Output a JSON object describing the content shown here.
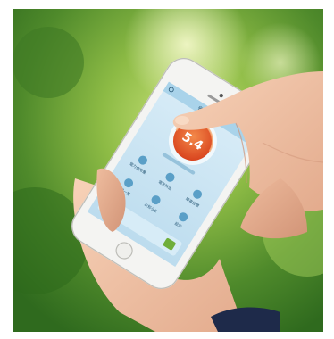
{
  "phone_screen": {
    "header_title": "省エネ状況",
    "gauge_value": "5.4",
    "menu_items": [
      {
        "label": "電力使用量",
        "icon": "bolt-icon"
      },
      {
        "label": "電気料金",
        "icon": "yen-icon"
      },
      {
        "label": "節電目標",
        "icon": "target-icon"
      },
      {
        "label": "機器一覧",
        "icon": "list-icon"
      },
      {
        "label": "お知らせ",
        "icon": "bell-icon"
      },
      {
        "label": "設定",
        "icon": "gear-icon"
      }
    ]
  },
  "colors": {
    "background_green": "#5f9a33",
    "gauge_orange": "#e8582a",
    "screen_blue": "#cfe6f4",
    "phone_white": "#f4f4f2"
  }
}
